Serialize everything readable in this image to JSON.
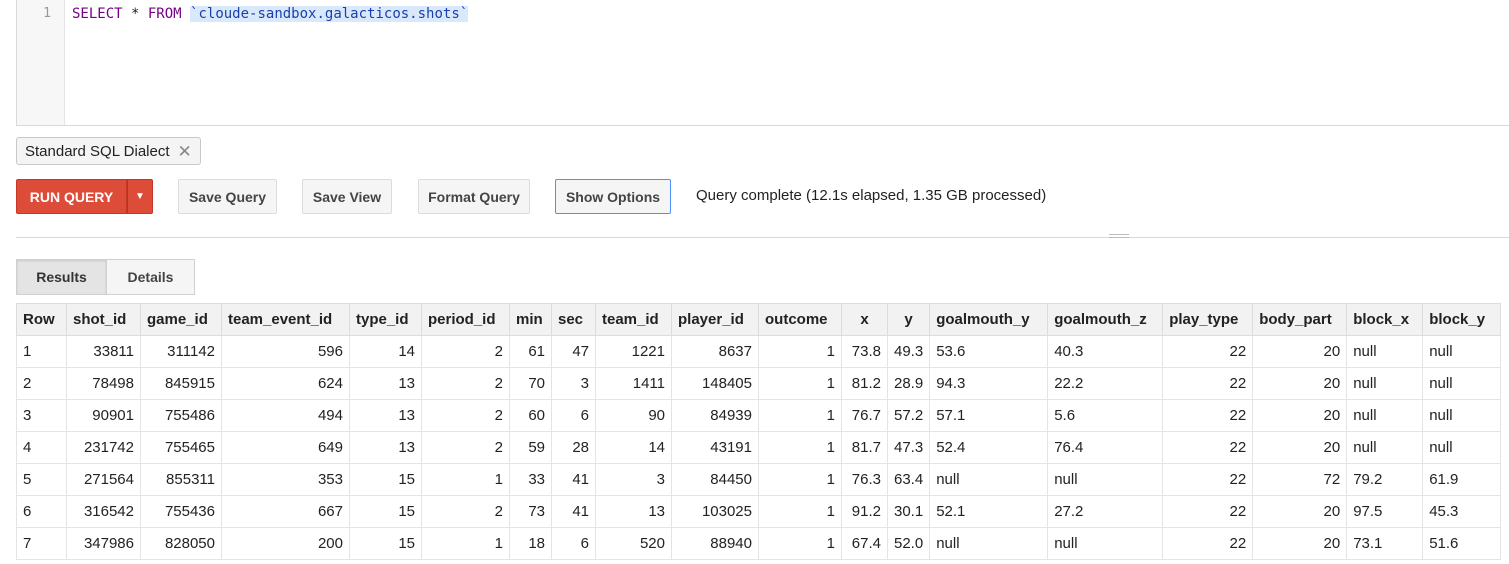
{
  "editor": {
    "line_number": "1",
    "keyword_select": "SELECT",
    "star": " * ",
    "keyword_from": "FROM",
    "table_ref": "`cloude-sandbox.galacticos.shots`"
  },
  "dialect_chip": {
    "label": "Standard SQL Dialect",
    "remove_icon": "close-icon"
  },
  "toolbar": {
    "run_label": "RUN QUERY",
    "run_dropdown_icon": "caret-down-icon",
    "save_query_label": "Save Query",
    "save_view_label": "Save View",
    "format_query_label": "Format Query",
    "show_options_label": "Show Options",
    "status": "Query complete (12.1s elapsed, 1.35 GB processed)"
  },
  "tabs": [
    "Results",
    "Details"
  ],
  "table": {
    "columns": [
      "Row",
      "shot_id",
      "game_id",
      "team_event_id",
      "type_id",
      "period_id",
      "min",
      "sec",
      "team_id",
      "player_id",
      "outcome",
      "x",
      "y",
      "goalmouth_y",
      "goalmouth_z",
      "play_type",
      "body_part",
      "block_x",
      "block_y"
    ],
    "rows": [
      [
        "1",
        "33811",
        "311142",
        "596",
        "14",
        "2",
        "61",
        "47",
        "1221",
        "8637",
        "1",
        "73.8",
        "49.3",
        "53.6",
        "40.3",
        "22",
        "20",
        "null",
        "null"
      ],
      [
        "2",
        "78498",
        "845915",
        "624",
        "13",
        "2",
        "70",
        "3",
        "1411",
        "148405",
        "1",
        "81.2",
        "28.9",
        "94.3",
        "22.2",
        "22",
        "20",
        "null",
        "null"
      ],
      [
        "3",
        "90901",
        "755486",
        "494",
        "13",
        "2",
        "60",
        "6",
        "90",
        "84939",
        "1",
        "76.7",
        "57.2",
        "57.1",
        "5.6",
        "22",
        "20",
        "null",
        "null"
      ],
      [
        "4",
        "231742",
        "755465",
        "649",
        "13",
        "2",
        "59",
        "28",
        "14",
        "43191",
        "1",
        "81.7",
        "47.3",
        "52.4",
        "76.4",
        "22",
        "20",
        "null",
        "null"
      ],
      [
        "5",
        "271564",
        "855311",
        "353",
        "15",
        "1",
        "33",
        "41",
        "3",
        "84450",
        "1",
        "76.3",
        "63.4",
        "null",
        "null",
        "22",
        "72",
        "79.2",
        "61.9"
      ],
      [
        "6",
        "316542",
        "755436",
        "667",
        "15",
        "2",
        "73",
        "41",
        "13",
        "103025",
        "1",
        "91.2",
        "30.1",
        "52.1",
        "27.2",
        "22",
        "20",
        "97.5",
        "45.3"
      ],
      [
        "7",
        "347986",
        "828050",
        "200",
        "15",
        "1",
        "18",
        "6",
        "520",
        "88940",
        "1",
        "67.4",
        "52.0",
        "null",
        "null",
        "22",
        "20",
        "73.1",
        "51.6"
      ]
    ]
  }
}
